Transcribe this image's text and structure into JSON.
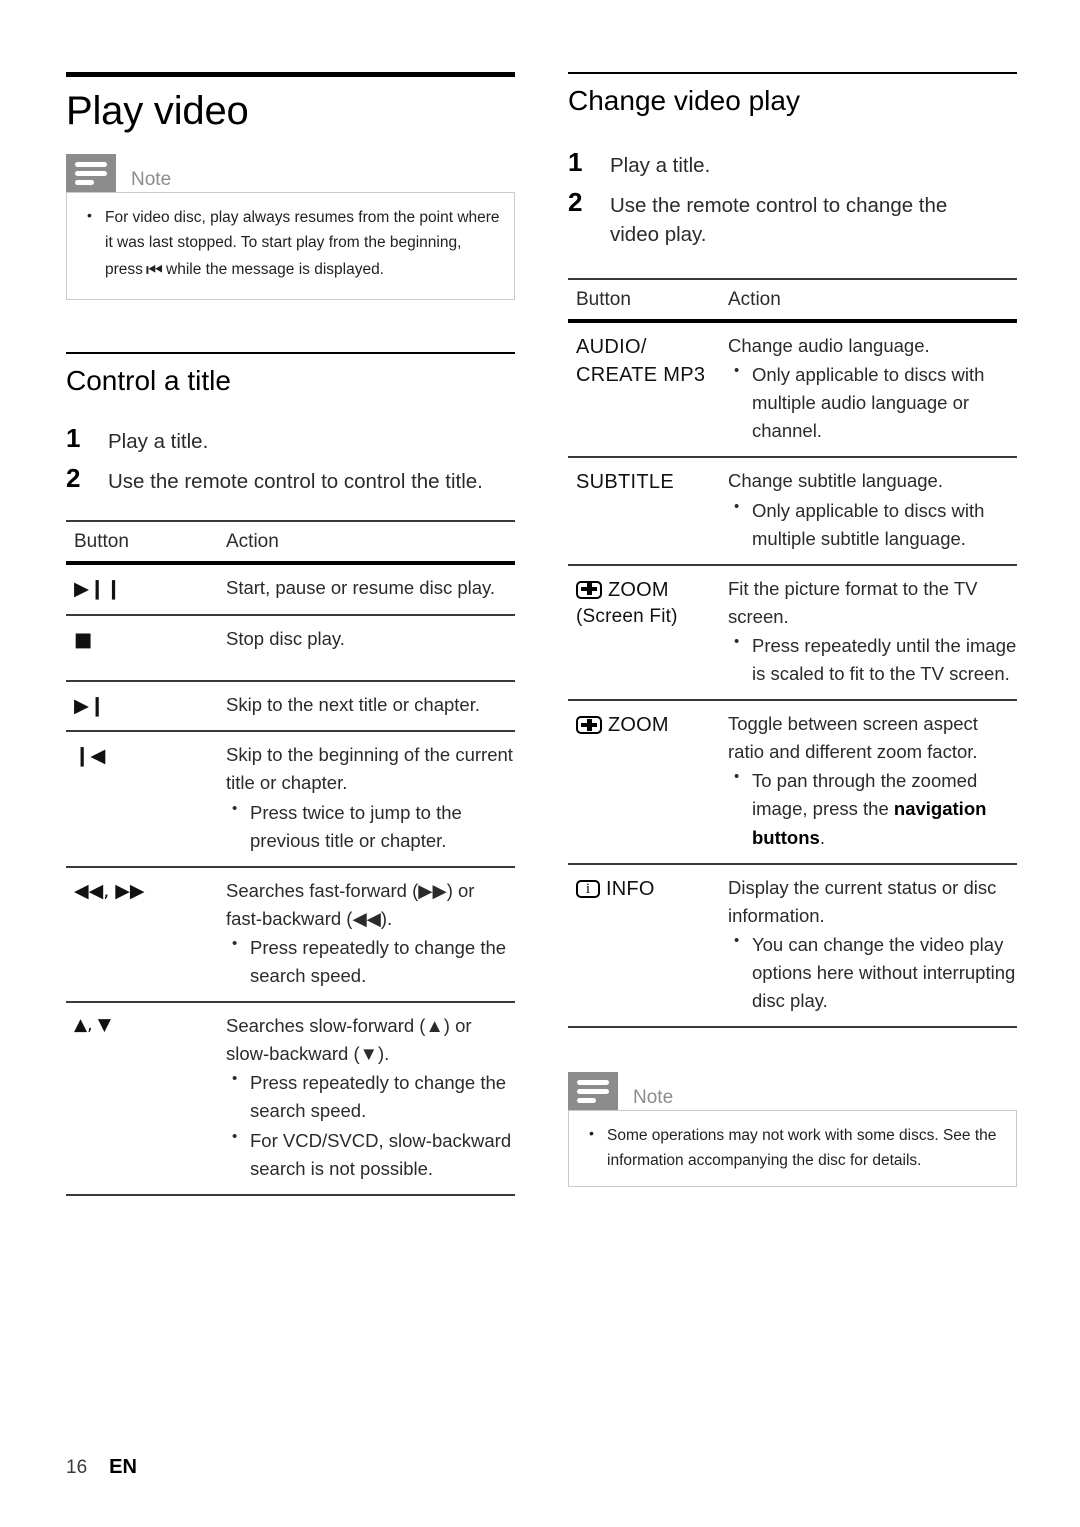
{
  "document": {
    "page_number": "16",
    "language_code": "EN"
  },
  "left_column": {
    "page_heading": "Play video",
    "note": {
      "label": "Note",
      "items": [
        {
          "text_before": "For video disc, play always resumes from the point where it was last stopped. To start play from the beginning, press",
          "glyph": "⏮",
          "text_after": "while the message is displayed."
        }
      ]
    },
    "section": {
      "heading": "Control a title",
      "steps": [
        {
          "num": "1",
          "text": "Play a title."
        },
        {
          "num": "2",
          "text": "Use the remote control to control the title."
        }
      ],
      "table": {
        "headers": {
          "button": "Button",
          "action": "Action"
        },
        "rows": [
          {
            "button_glyph": "▶❙❙",
            "button_name": "play-pause-icon",
            "action": "Start, pause or resume disc play.",
            "bullets": []
          },
          {
            "button_glyph": "■",
            "button_name": "stop-icon",
            "action": "Stop disc play.",
            "bullets": []
          },
          {
            "button_glyph": "▶❙",
            "button_name": "next-skip-icon",
            "action": "Skip to the next title or chapter.",
            "bullets": []
          },
          {
            "button_glyph": "❙◀",
            "button_name": "previous-skip-icon",
            "action": "Skip to the beginning of the current title or chapter.",
            "bullets": [
              "Press twice to jump to the previous title or chapter."
            ]
          },
          {
            "button_glyph": "◀◀,  ▶▶",
            "button_name": "fast-search-icon",
            "action_html": "Searches fast-forward (▶▶) or fast-backward (◀◀).",
            "bullets": [
              "Press repeatedly to change the search speed."
            ]
          },
          {
            "button_glyph": "▲, ▼",
            "button_name": "slow-search-icon",
            "action_html": "Searches slow-forward (▲) or slow-backward (▼).",
            "bullets": [
              "Press repeatedly to change the search speed.",
              "For VCD/SVCD, slow-backward search is not possible."
            ]
          }
        ]
      }
    }
  },
  "right_column": {
    "section": {
      "heading": "Change video play",
      "steps": [
        {
          "num": "1",
          "text": "Play a title."
        },
        {
          "num": "2",
          "text": "Use the remote control to change the video play."
        }
      ],
      "table": {
        "headers": {
          "button": "Button",
          "action": "Action"
        },
        "rows": [
          {
            "button_label_line1": "AUDIO/",
            "button_label_line2": "CREATE MP3",
            "icon": "",
            "action": "Change audio language.",
            "bullets": [
              "Only applicable to discs with multiple audio language or channel."
            ]
          },
          {
            "button_label_line1": "SUBTITLE",
            "button_label_line2": "",
            "icon": "",
            "action": "Change subtitle language.",
            "bullets": [
              "Only applicable to discs with multiple subtitle language."
            ]
          },
          {
            "button_label_line1": "ZOOM",
            "button_label_line2": "(Screen Fit)",
            "icon": "zoom-icon",
            "action": "Fit the picture format to the TV screen.",
            "bullets": [
              "Press repeatedly until the image is scaled to fit to the TV screen."
            ]
          },
          {
            "button_label_line1": "ZOOM",
            "button_label_line2": "",
            "icon": "zoom-icon",
            "action": "Toggle between screen aspect ratio and different zoom factor.",
            "bullets": [
              "To pan through the zoomed image, press the navigation buttons."
            ],
            "bullet_bold_tail": "navigation buttons"
          },
          {
            "button_label_line1": "INFO",
            "button_label_line2": "",
            "icon": "info-icon",
            "action": "Display the current status or disc information.",
            "bullets": [
              "You can change the video play options here without interrupting disc play."
            ]
          }
        ]
      }
    },
    "note": {
      "label": "Note",
      "items": [
        {
          "text_before": "Some operations may not work with some discs. See the information accompanying the disc for details.",
          "glyph": "",
          "text_after": ""
        }
      ]
    }
  },
  "colors": {
    "note_icon_bg": "#8c8c8c",
    "note_label": "#8c8c8c",
    "note_border": "#c9c9c9",
    "rule_dark": "#000000",
    "rule_mid": "#3a3a3a"
  }
}
